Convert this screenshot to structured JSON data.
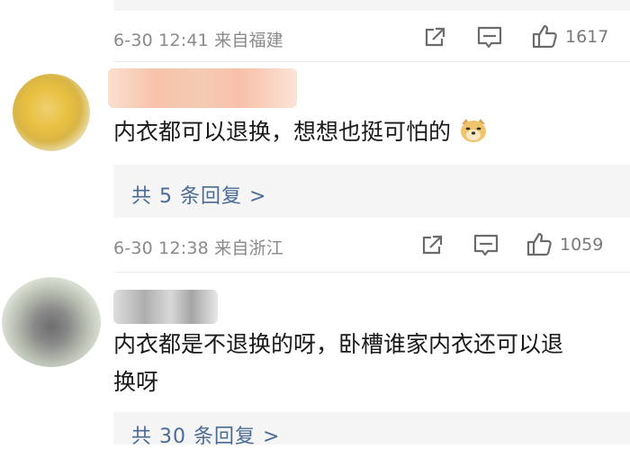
{
  "comments": [
    {
      "meta": "6-30 12:41 来自福建",
      "like_count": "1617"
    },
    {
      "text": "内衣都可以退换，想想也挺可怕的",
      "emoji": "dog-emoji",
      "reply_label": "共 5 条回复 >",
      "meta": "6-30 12:38 来自浙江",
      "like_count": "1059"
    },
    {
      "text_line1": "内衣都是不退换的呀，卧槽谁家内衣还可以退",
      "text_line2": "换呀",
      "reply_label": "共 30 条回复 >"
    }
  ],
  "icons": {
    "share": "share-icon",
    "comment": "comment-icon",
    "like": "thumbs-up-icon"
  },
  "colors": {
    "link": "#4a6b95",
    "meta": "#8a8a8a",
    "reply_bg": "#f5f5f5"
  }
}
